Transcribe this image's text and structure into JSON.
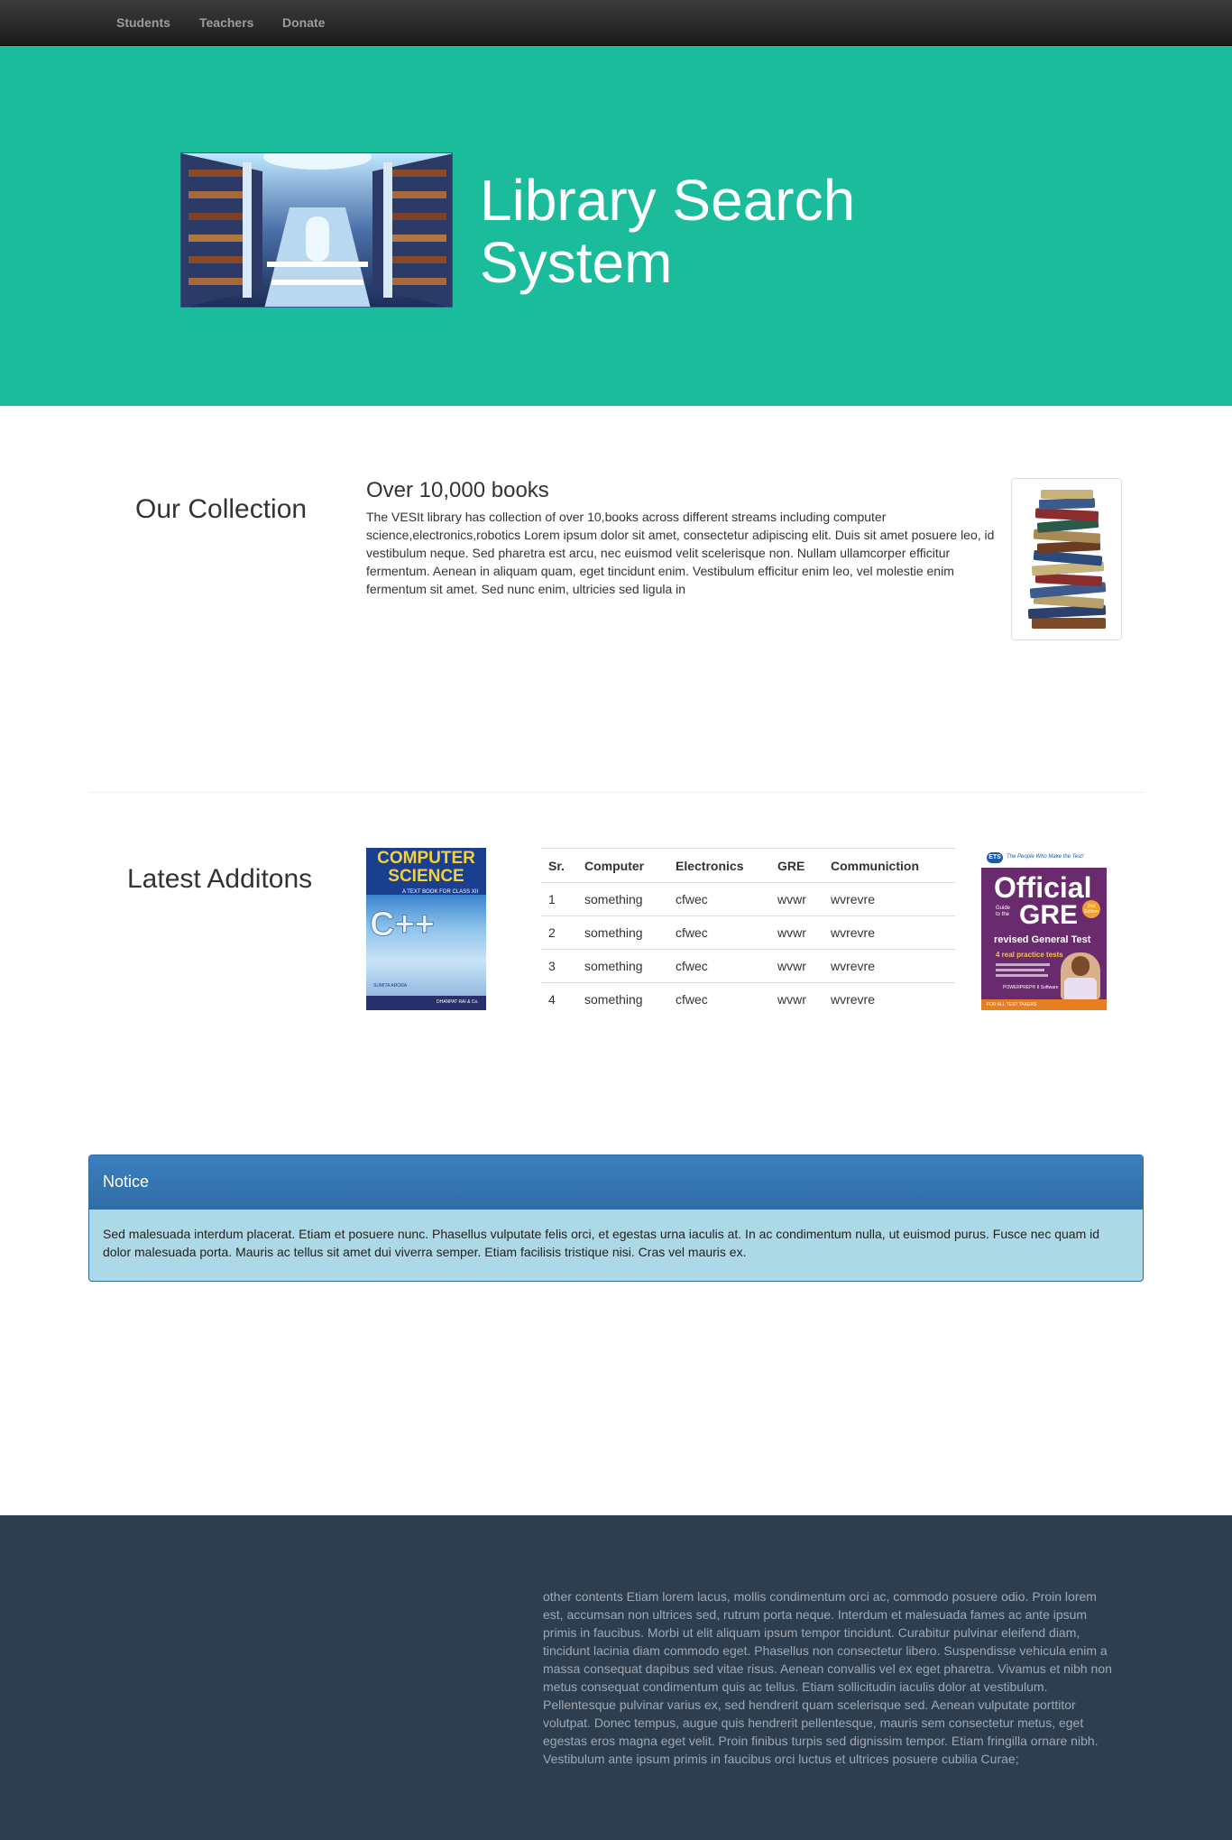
{
  "nav": {
    "items": [
      {
        "label": "Students"
      },
      {
        "label": "Teachers"
      },
      {
        "label": "Donate"
      }
    ]
  },
  "hero": {
    "title": "Library Search System"
  },
  "collection": {
    "heading": "Our Collection",
    "subheading": "Over 10,000 books",
    "text": "The VESIt library has collection of over 10,books across different streams including computer science,electronics,robotics Lorem ipsum dolor sit amet, consectetur adipiscing elit. Duis sit amet posuere leo, id vestibulum neque. Sed pharetra est arcu, nec euismod velit scelerisque non. Nullam ullamcorper efficitur fermentum. Aenean in aliquam quam, eget tincidunt enim. Vestibulum efficitur enim leo, vel molestie enim fermentum sit amet. Sed nunc enim, ultricies sed ligula in"
  },
  "latest": {
    "heading": "Latest Additons",
    "book1": {
      "title_line1": "COMPUTER",
      "title_line2": "SCIENCE",
      "subtitle": "A TEXT BOOK FOR CLASS XII",
      "big": "C++",
      "author": "SUMITA ARORA",
      "publisher": "DHANPAT RAI & Co."
    },
    "book2": {
      "top": "The People Who Make the Test!",
      "ets": "ETS",
      "official": "Official",
      "guide": "Guide to the",
      "gre": "GRE",
      "edition": "2nd Edition",
      "revised": "revised General Test",
      "tests": "4 real practice tests",
      "powerprep": "POWERPREP® II Software",
      "bottom": "FOR ALL TEST TAKERS"
    },
    "table": {
      "headers": [
        "Sr.",
        "Computer",
        "Electronics",
        "GRE",
        "Communiction"
      ],
      "rows": [
        [
          "1",
          "something",
          "cfwec",
          "wvwr",
          "wvrevre"
        ],
        [
          "2",
          "something",
          "cfwec",
          "wvwr",
          "wvrevre"
        ],
        [
          "3",
          "something",
          "cfwec",
          "wvwr",
          "wvrevre"
        ],
        [
          "4",
          "something",
          "cfwec",
          "wvwr",
          "wvrevre"
        ]
      ]
    }
  },
  "notice": {
    "heading": "Notice",
    "body": "Sed malesuada interdum placerat. Etiam et posuere nunc. Phasellus vulputate felis orci, et egestas urna iaculis at. In ac condimentum nulla, ut euismod purus. Fusce nec quam id dolor malesuada porta. Mauris ac tellus sit amet dui viverra semper. Etiam facilisis tristique nisi. Cras vel mauris ex."
  },
  "footer": {
    "text": "other contents Etiam lorem lacus, mollis condimentum orci ac, commodo posuere odio. Proin lorem est, accumsan non ultrices sed, rutrum porta neque. Interdum et malesuada fames ac ante ipsum primis in faucibus. Morbi ut elit aliquam ipsum tempor tincidunt. Curabitur pulvinar eleifend diam, tincidunt lacinia diam commodo eget. Phasellus non consectetur libero. Suspendisse vehicula enim a massa consequat dapibus sed vitae risus. Aenean convallis vel ex eget pharetra. Vivamus et nibh non metus consequat condimentum quis ac tellus. Etiam sollicitudin iaculis dolor at vestibulum. Pellentesque pulvinar varius ex, sed hendrerit quam scelerisque sed. Aenean vulputate porttitor volutpat. Donec tempus, augue quis hendrerit pellentesque, mauris sem consectetur metus, eget egestas eros magna eget velit. Proin finibus turpis sed dignissim tempor. Etiam fringilla ornare nibh. Vestibulum ante ipsum primis in faucibus orci luctus et ultrices posuere cubilia Curae;"
  },
  "colors": {
    "hero_bg": "#1abc9c",
    "footer_bg": "#2c3e50",
    "notice_heading": "#2e6da4",
    "notice_body": "#add8e6",
    "navbar_bg": "#222222"
  }
}
